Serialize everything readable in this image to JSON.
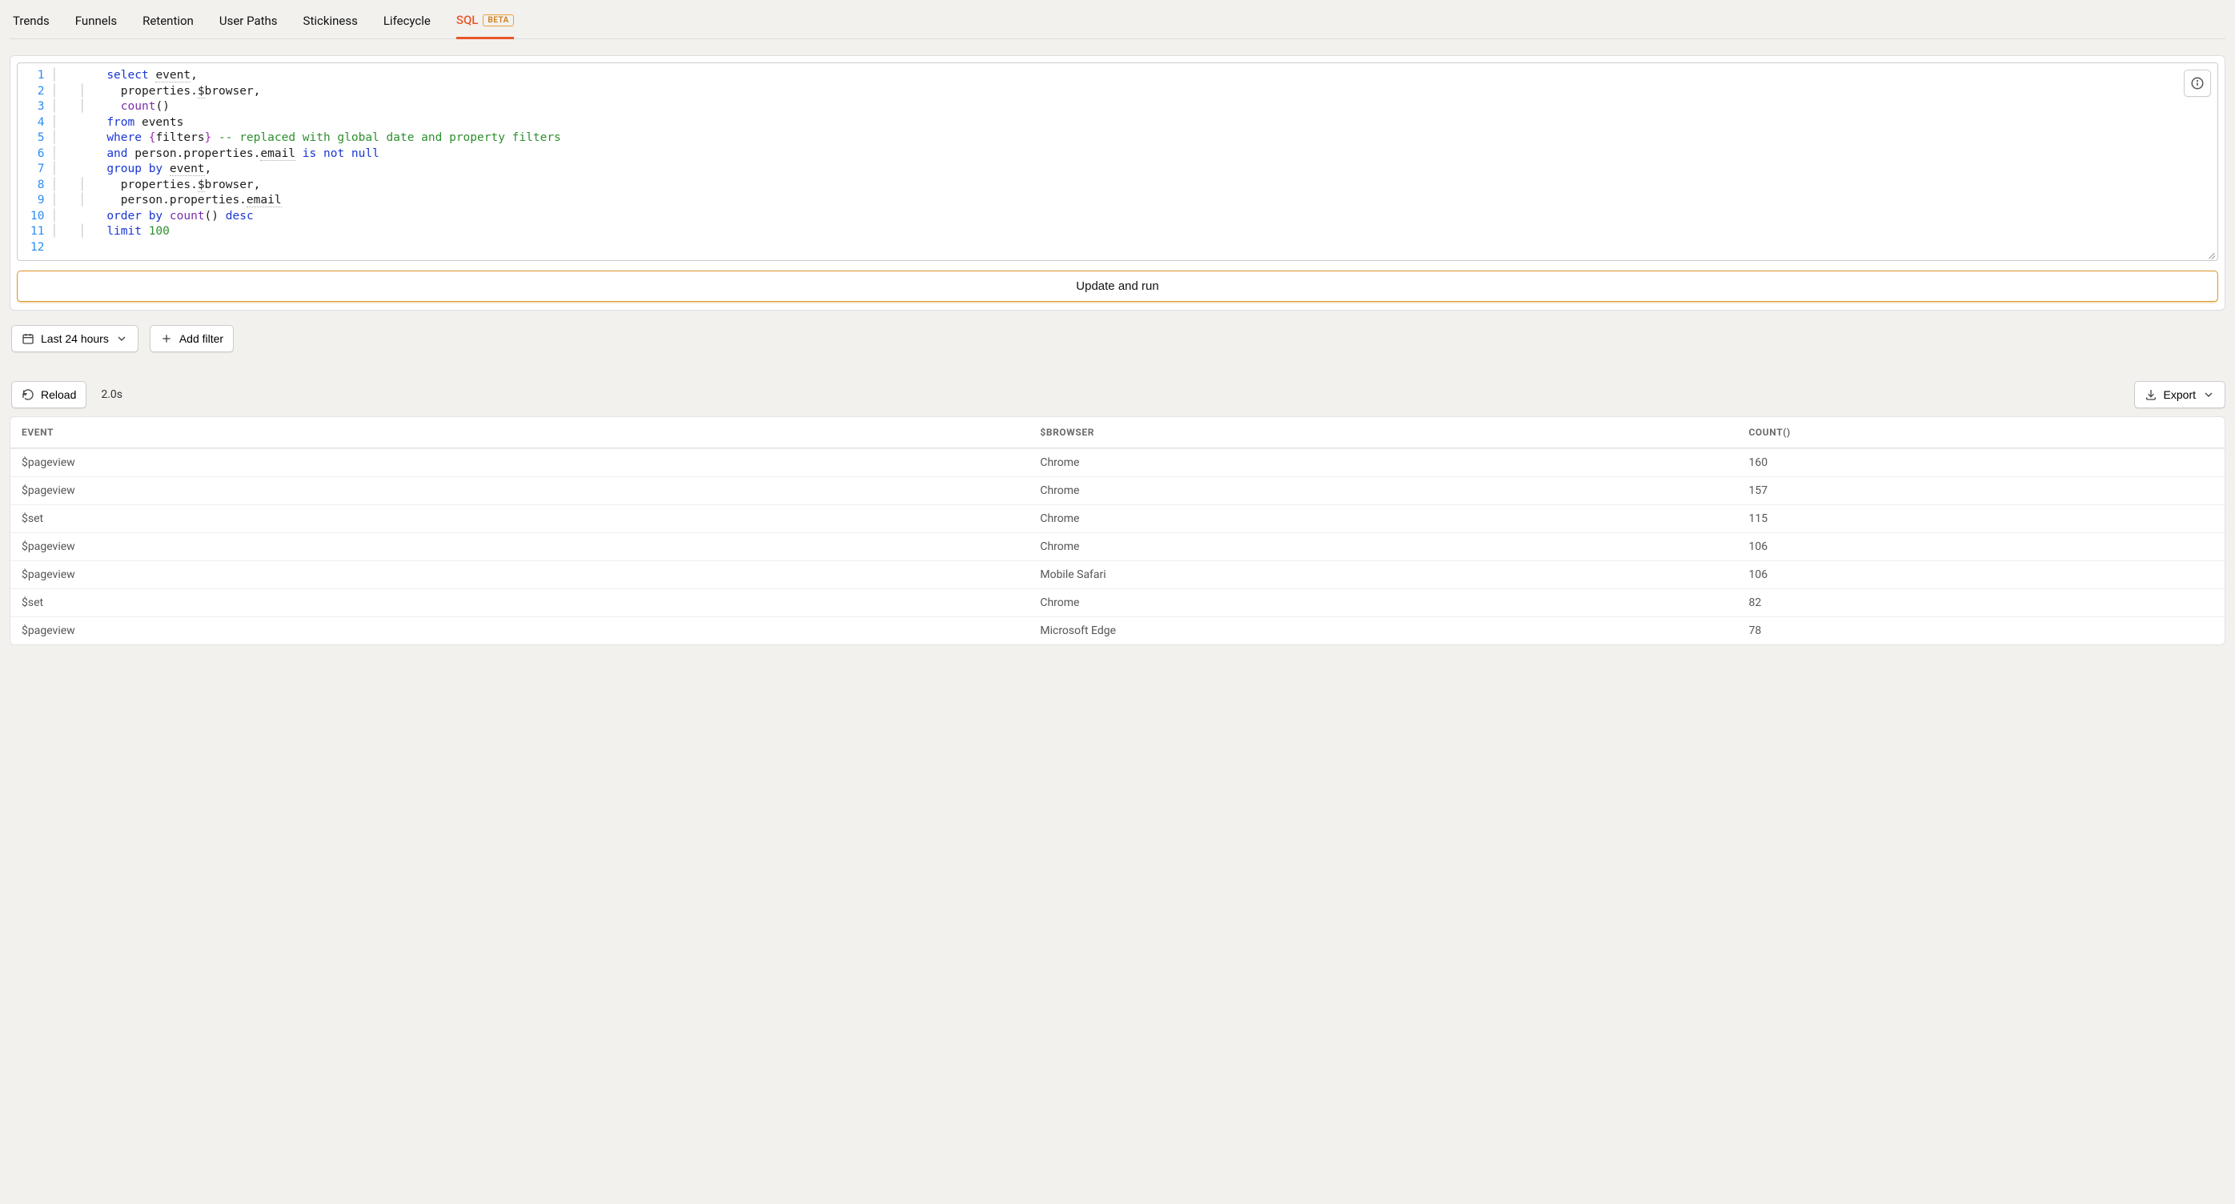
{
  "tabs": {
    "items": [
      {
        "label": "Trends",
        "active": false
      },
      {
        "label": "Funnels",
        "active": false
      },
      {
        "label": "Retention",
        "active": false
      },
      {
        "label": "User Paths",
        "active": false
      },
      {
        "label": "Stickiness",
        "active": false
      },
      {
        "label": "Lifecycle",
        "active": false
      },
      {
        "label": "SQL",
        "active": true,
        "badge": "BETA"
      }
    ]
  },
  "editor": {
    "lines": [
      "select event,",
      "       properties.$browser,",
      "       count()",
      "  from events",
      " where {filters} -- replaced with global date and property filters",
      "   and person.properties.email is not null",
      "group by event,",
      "       properties.$browser,",
      "       person.properties.email",
      "order by count() desc",
      " limit 100",
      ""
    ]
  },
  "buttons": {
    "run": "Update and run",
    "date_range": "Last 24 hours",
    "add_filter": "Add filter",
    "reload": "Reload",
    "export": "Export"
  },
  "results": {
    "elapsed": "2.0s",
    "columns": [
      "EVENT",
      "$BROWSER",
      "COUNT()"
    ],
    "rows": [
      {
        "event": "$pageview",
        "browser": "Chrome",
        "count": "160"
      },
      {
        "event": "$pageview",
        "browser": "Chrome",
        "count": "157"
      },
      {
        "event": "$set",
        "browser": "Chrome",
        "count": "115"
      },
      {
        "event": "$pageview",
        "browser": "Chrome",
        "count": "106"
      },
      {
        "event": "$pageview",
        "browser": "Mobile Safari",
        "count": "106"
      },
      {
        "event": "$set",
        "browser": "Chrome",
        "count": "82"
      },
      {
        "event": "$pageview",
        "browser": "Microsoft Edge",
        "count": "78"
      }
    ]
  }
}
